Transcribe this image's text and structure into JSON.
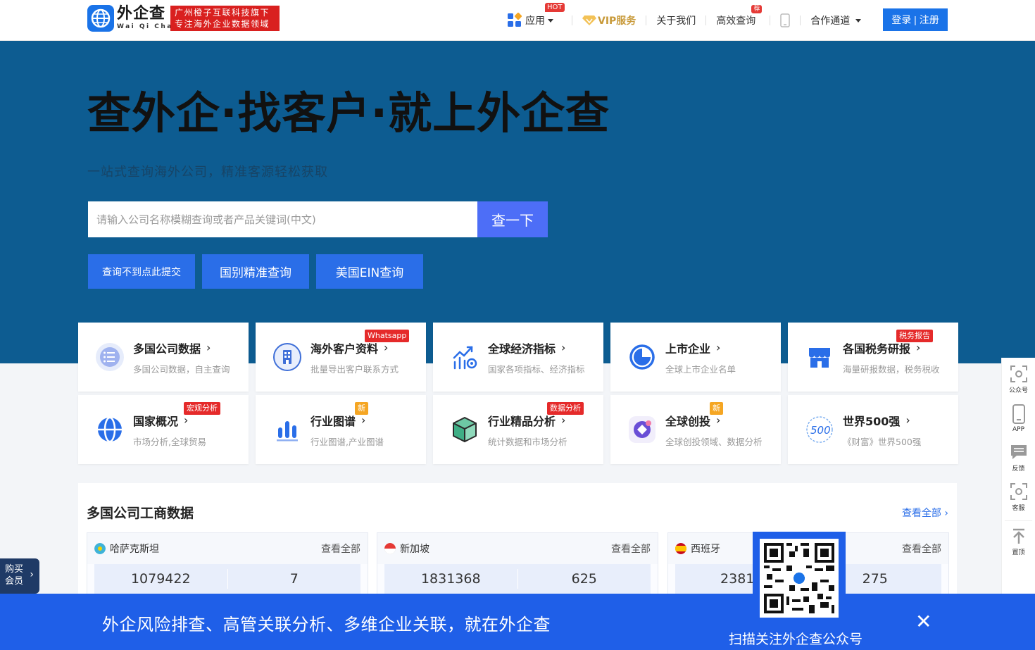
{
  "header": {
    "logo_cn": "外企查",
    "logo_en": "Wai Qi Cha",
    "slogan_line1": "广州橙子互联科技旗下",
    "slogan_line2": "专注海外企业数据领域",
    "nav": {
      "apps": "应用",
      "apps_badge": "HOT",
      "vip": "VIP服务",
      "about": "关于我们",
      "efficient": "高效查询",
      "efficient_badge": "荐",
      "partner": "合作通道"
    },
    "login": "登录 | 注册"
  },
  "hero": {
    "title": "查外企·找客户·就上外企查",
    "subtitle": "一站式查询海外公司，精准客源轻松获取",
    "search_placeholder": "请输入公司名称模糊查询或者产品关键词(中文)",
    "search_button": "查一下",
    "btn_submit": "查询不到点此提交",
    "btn_country": "国别精准查询",
    "btn_ein": "美国EIN查询"
  },
  "features": [
    {
      "title": "多国公司数据",
      "desc": "多国公司数据，自主查询",
      "badge": "",
      "icon": "list-icon"
    },
    {
      "title": "海外客户资料",
      "desc": "批量导出客户联系方式",
      "badge": "Whatsapp",
      "icon": "building-icon"
    },
    {
      "title": "全球经济指标",
      "desc": "国家各项指标、经济指标",
      "badge": "",
      "icon": "chart-gear-icon"
    },
    {
      "title": "上市企业",
      "desc": "全球上市企业名单",
      "badge": "",
      "icon": "pie-icon"
    },
    {
      "title": "各国税务研报",
      "desc": "海量研报数据，税务税收",
      "badge": "税务报告",
      "icon": "store-icon"
    },
    {
      "title": "国家概况",
      "desc": "市场分析,全球贸易",
      "badge": "宏观分析",
      "icon": "globe-icon"
    },
    {
      "title": "行业图谱",
      "desc": "行业图谱,产业图谱",
      "badge": "新",
      "icon": "bar-icon"
    },
    {
      "title": "行业精品分析",
      "desc": "统计数据和市场分析",
      "badge": "数据分析",
      "icon": "cube-icon"
    },
    {
      "title": "全球创投",
      "desc": "全球创投领域、数据分析",
      "badge": "新",
      "icon": "venture-icon"
    },
    {
      "title": "世界500强",
      "desc": "《财富》世界500强",
      "badge": "",
      "icon": "500-icon"
    }
  ],
  "section": {
    "title": "多国公司工商数据",
    "view_all": "查看全部",
    "countries": [
      {
        "name": "哈萨克斯坦",
        "more": "查看全部",
        "stat1": "1079422",
        "stat2": "7"
      },
      {
        "name": "新加坡",
        "more": "查看全部",
        "stat1": "1831368",
        "stat2": "625"
      },
      {
        "name": "西班牙",
        "more": "查看全部",
        "stat1": "23813",
        "stat2": "275"
      }
    ]
  },
  "side": {
    "wechat": "公众号",
    "app": "APP",
    "feedback": "反馈",
    "service": "客服",
    "top": "置顶"
  },
  "buy": {
    "line1": "购买",
    "line2": "会员"
  },
  "banner": {
    "text": "外企风险排查、高管关联分析、多维企业关联，就在外企查",
    "qr_caption": "扫描关注外企查公众号"
  },
  "colors": {
    "hero_bg": "#0d5c91",
    "primary": "#1a73e8",
    "banner": "#1f5fe8",
    "badge_red": "#e52a2a",
    "badge_orange": "#f5a623"
  }
}
